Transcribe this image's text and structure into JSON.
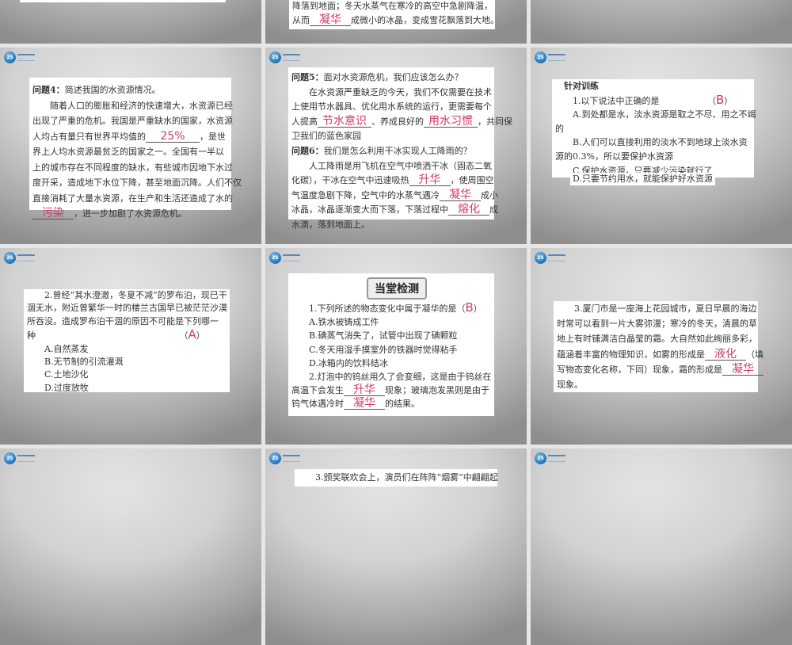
{
  "colors": {
    "answer": "#d2386a",
    "slide_bg": "#d2d2d2",
    "sorter_bg": "#e6e6e6"
  },
  "logo_icon": "logo-globe",
  "slides": [
    {
      "lines": []
    },
    {
      "lines": [
        [
          {
            "t": "降落到地面；冬天水蒸气在寒冷的高空中急剧降温，"
          }
        ],
        [
          {
            "t": "从而"
          },
          {
            "a": "凝华"
          },
          {
            "t": "成微小的冰晶，变成雪花飘落到大地。"
          }
        ]
      ]
    },
    {
      "lines": []
    },
    {
      "lines": [
        [
          {
            "b": "问题4："
          },
          {
            "t": "简述我国的水资源情况。"
          }
        ],
        [
          {
            "t": "　　随着人口的膨胀和经济的快速增大，水资源已经"
          }
        ],
        [
          {
            "t": "出现了严重的危机。我国是严重缺水的国家，水资源"
          }
        ],
        [
          {
            "t": "人均占有量只有世界平均值的"
          },
          {
            "a": "25%"
          },
          {
            "t": "，是世"
          }
        ],
        [
          {
            "t": "界上人均水资源最贫乏的国家之一。全国有一半以"
          }
        ],
        [
          {
            "t": "上的城市存在不同程度的缺水，有些城市因地下水过"
          }
        ],
        [
          {
            "t": "度开采，造成地下水位下降，甚至地面沉降。人们不仅"
          }
        ],
        [
          {
            "t": "直接消耗了大量水资源，在生产和生活还造成了水的"
          }
        ],
        [
          {
            "a": "污染"
          },
          {
            "t": "，进一步加剧了水资源危机。"
          }
        ]
      ]
    },
    {
      "lines": [
        [
          {
            "b": "问题5："
          },
          {
            "t": "面对水资源危机，我们应该怎么办？"
          }
        ],
        [
          {
            "t": "　　在水资源严重缺乏的今天，我们不仅需要在技术"
          }
        ],
        [
          {
            "t": "上使用节水器具、优化用水系统的运行，更需要每个"
          }
        ],
        [
          {
            "t": "人提高"
          },
          {
            "a": "节水意识"
          },
          {
            "t": "、养成良好的"
          },
          {
            "a": "用水习惯"
          },
          {
            "t": "，共同保"
          }
        ],
        [
          {
            "t": "卫我们的蓝色家园"
          }
        ],
        [
          {
            "b": "问题6："
          },
          {
            "t": "我们是怎么利用干冰实现人工降雨的？"
          }
        ],
        [
          {
            "t": "　　人工降雨是用飞机在空气中喷洒干冰（固态二氧"
          }
        ],
        [
          {
            "t": "化碳），干冰在空气中迅速吸热"
          },
          {
            "a": "升华"
          },
          {
            "t": "，使周围空"
          }
        ],
        [
          {
            "t": "气温度急剧下降，空气中的水蒸气遇冷"
          },
          {
            "a": "凝华"
          },
          {
            "t": "成小"
          }
        ],
        [
          {
            "t": "冰晶，冰晶逐渐变大而下落，下落过程中"
          },
          {
            "a": "熔化"
          },
          {
            "t": "成"
          }
        ],
        [
          {
            "t": "水滴，落到地面上。"
          }
        ]
      ]
    },
    {
      "lines": [
        [
          {
            "b": "　针对训练"
          }
        ],
        [
          {
            "t": "　　1.以下说法中正确的是　　　　　　（"
          },
          {
            "c": "B"
          },
          {
            "t": "）"
          }
        ],
        [
          {
            "t": "　　A.到处都是水，淡水资源是取之不尽、用之不竭"
          }
        ],
        [
          {
            "t": "的"
          }
        ],
        [
          {
            "t": "　　B.人们可以直接利用的淡水不到地球上淡水资"
          }
        ],
        [
          {
            "t": "源的0.3%，所以要保护水资源"
          }
        ],
        [
          {
            "t": "　　C.保护水资源，只要减少污染就行了"
          }
        ]
      ],
      "extra_line": "D.只要节约用水，就能保护好水资源"
    },
    {
      "lines": [
        [
          {
            "t": "　　2.曾经“其水澄澈，冬夏不减”的罗布泊，现已干"
          }
        ],
        [
          {
            "t": "涸无水，附近曾繁华一时的楼兰古国早已被茫茫沙漠"
          }
        ],
        [
          {
            "t": "所吞没。造成罗布泊干涸的原因不可能是下列哪一"
          }
        ],
        [
          {
            "t": "种　　　　　　　　　　　　　　　　　（"
          },
          {
            "c": "A"
          },
          {
            "t": "）"
          }
        ],
        [
          {
            "t": "　　A.自然蒸发"
          }
        ],
        [
          {
            "t": "　　B.无节制的引流灌溉"
          }
        ],
        [
          {
            "t": "　　C.土地沙化"
          }
        ],
        [
          {
            "t": "　　D.过度放牧"
          }
        ]
      ]
    },
    {
      "banner": "当堂检测",
      "lines": [
        [
          {
            "t": "　　1.下列所述的物态变化中属于凝华的是（"
          },
          {
            "c": "B"
          },
          {
            "t": "）"
          }
        ],
        [
          {
            "t": "　　A.铁水被铸成工件"
          }
        ],
        [
          {
            "t": "　　B.碘蒸气消失了，试管中出现了碘颗粒"
          }
        ],
        [
          {
            "t": "　　C.冬天用湿手摸室外的铁器时觉得粘手"
          }
        ],
        [
          {
            "t": "　　D.冰箱内的饮料结冰"
          }
        ],
        [
          {
            "t": "　　2.灯泡中的钨丝用久了会变细，这是由于钨丝在"
          }
        ],
        [
          {
            "t": "高温下会发生"
          },
          {
            "a": "升华"
          },
          {
            "t": "现象；玻璃泡发黑则是由于"
          }
        ],
        [
          {
            "t": "钨气体遇冷时"
          },
          {
            "a": "凝华"
          },
          {
            "t": "的结果。"
          }
        ]
      ]
    },
    {
      "lines": [
        [
          {
            "t": "　　3.厦门市是一座海上花园城市，夏日早晨的海边"
          }
        ],
        [
          {
            "t": "时常可以看到一片大雾弥漫；寒冷的冬天，清晨的草"
          }
        ],
        [
          {
            "t": "地上有时铺满洁白晶莹的霜。大自然如此绚丽多彩，"
          }
        ],
        [
          {
            "t": "蕴涵着丰富的物理知识，如雾的形成是"
          },
          {
            "a": "液化"
          },
          {
            "t": "（填"
          }
        ],
        [
          {
            "t": "写物态变化名称，下同）现象，霜的形成是"
          },
          {
            "a": "凝华"
          }
        ],
        [
          {
            "t": "现象。"
          }
        ]
      ]
    },
    {
      "lines": []
    },
    {
      "lines": [
        [
          {
            "t": "　　3.颁奖联欢会上，演员们在阵阵“烟雾”中翩翩起"
          }
        ]
      ]
    },
    {
      "lines": []
    }
  ]
}
